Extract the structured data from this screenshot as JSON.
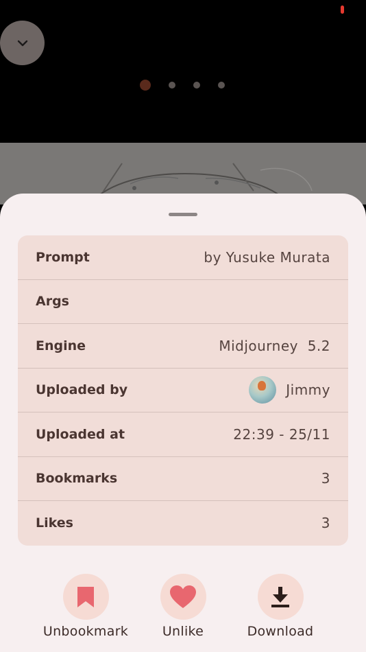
{
  "pager": {
    "count": 4,
    "active_index": 0
  },
  "details": {
    "rows": [
      {
        "label": "Prompt",
        "value": "by Yusuke Murata"
      },
      {
        "label": "Args",
        "value": ""
      },
      {
        "label": "Engine",
        "value": "Midjourney  5.2"
      },
      {
        "label": "Uploaded by",
        "value": "Jimmy",
        "avatar": true
      },
      {
        "label": "Uploaded at",
        "value": "22:39 - 25/11"
      },
      {
        "label": "Bookmarks",
        "value": "3"
      },
      {
        "label": "Likes",
        "value": "3"
      }
    ]
  },
  "actions": {
    "unbookmark": {
      "label": "Unbookmark",
      "icon": "bookmark-icon"
    },
    "unlike": {
      "label": "Unlike",
      "icon": "heart-icon"
    },
    "download": {
      "label": "Download",
      "icon": "download-icon"
    }
  },
  "colors": {
    "accent": "#e8676f",
    "sheet_background": "#f7eff0",
    "card_background": "#f1ddd8",
    "action_circle": "#f6dbd4",
    "status_indicator": "#e5392f"
  }
}
